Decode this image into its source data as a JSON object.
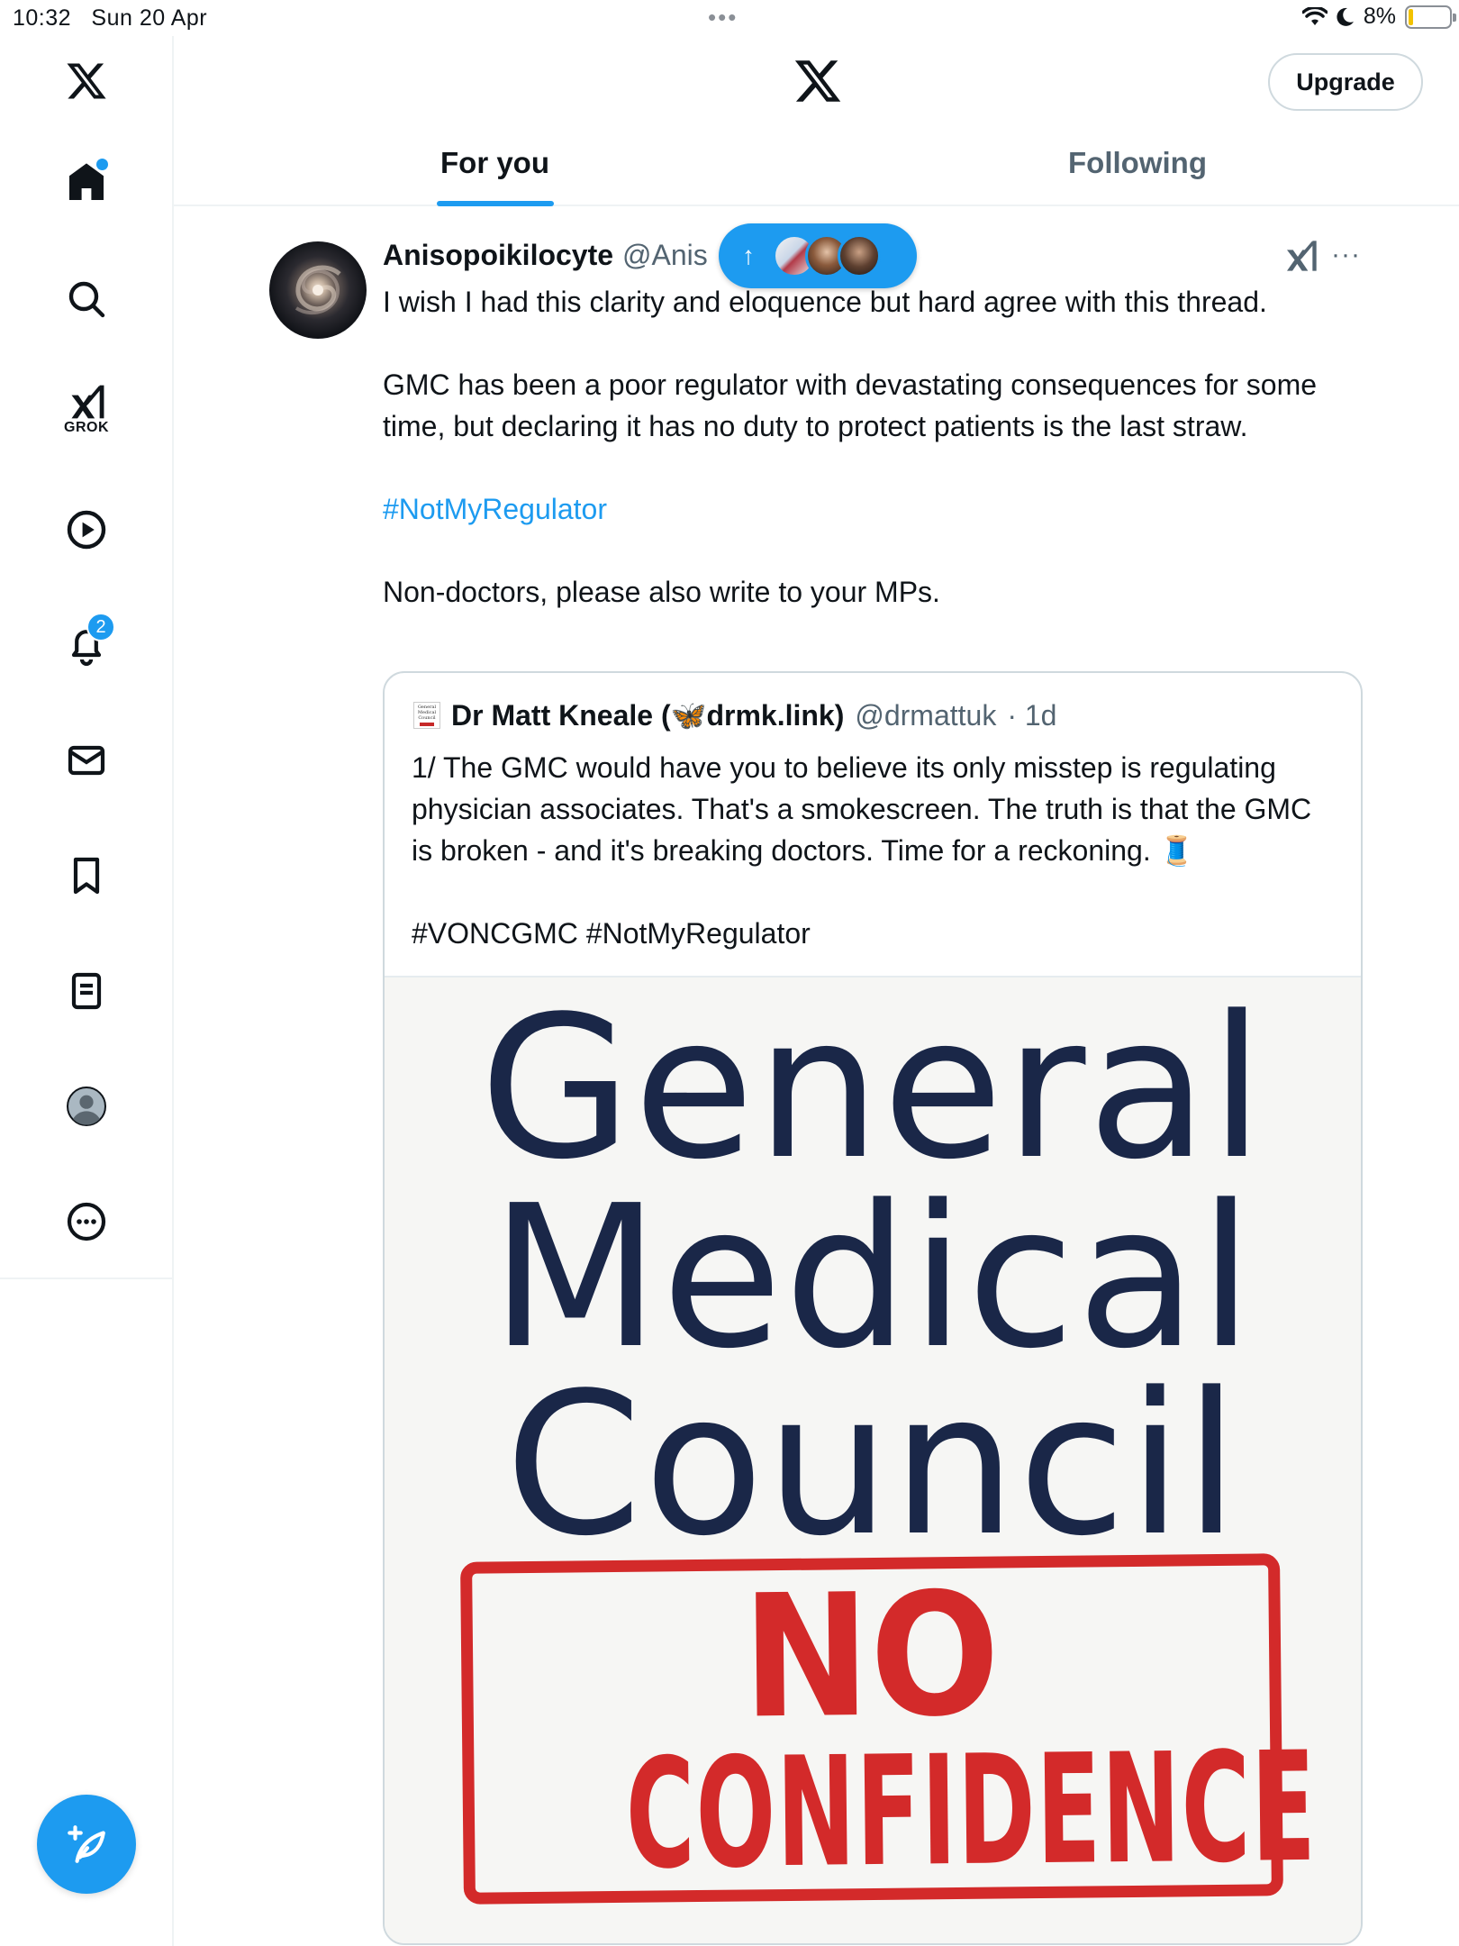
{
  "status_bar": {
    "time": "10:32",
    "date": "Sun 20 Apr",
    "battery": "8%",
    "dots": "•••"
  },
  "header": {
    "upgrade_label": "Upgrade",
    "tabs": [
      {
        "label": "For you",
        "active": true
      },
      {
        "label": "Following",
        "active": false
      }
    ]
  },
  "sidebar": {
    "items": [
      {
        "name": "home",
        "icon": "home-icon"
      },
      {
        "name": "search",
        "icon": "search-icon"
      },
      {
        "name": "grok",
        "icon": "grok-icon",
        "label": "GROK"
      },
      {
        "name": "video",
        "icon": "play-icon"
      },
      {
        "name": "notifications",
        "icon": "bell-icon",
        "badge": "2"
      },
      {
        "name": "messages",
        "icon": "mail-icon"
      },
      {
        "name": "bookmarks",
        "icon": "bookmark-icon"
      },
      {
        "name": "lists",
        "icon": "list-icon"
      },
      {
        "name": "profile",
        "icon": "profile-icon"
      },
      {
        "name": "more",
        "icon": "more-icon"
      }
    ],
    "compose_icon": "compose-icon"
  },
  "tweet": {
    "name": "Anisopoikilocyte",
    "handle": "@Anis",
    "paragraphs": [
      "I wish I had this clarity and eloquence but hard agree with this thread.",
      "",
      "GMC has been a poor regulator with devastating consequences for some time, but declaring it has no duty to protect patients is the last straw.",
      "",
      "#NotMyRegulator",
      "",
      "Non-doctors, please also write to your MPs."
    ],
    "hashtag": "#NotMyRegulator"
  },
  "quote": {
    "name": "Dr Matt Kneale (🦋drmk.link)",
    "name_prefix": "Dr Matt Kneale (",
    "name_suffix": "drmk.link)",
    "handle": "@drmattuk",
    "time": "· 1d",
    "avatar_text": [
      "General",
      "Medical",
      "Council"
    ],
    "paragraphs": [
      "1/ The GMC would have you to believe its only misstep is regulating physician associates. That's a smokescreen. The truth is that the GMC is broken - and it's breaking doctors. Time for a reckoning. 🧵",
      "",
      "#VONCGMC #NotMyRegulator"
    ],
    "image": {
      "line1": "General",
      "line2": "Medical",
      "line3": "Council",
      "stamp_line1": "NO",
      "stamp_line2": "CONFIDENCE"
    }
  },
  "colors": {
    "accent": "#1d9bf0",
    "text": "#0f1419",
    "muted": "#536471",
    "navy": "#1a2748",
    "stamp_red": "#d32a2a"
  }
}
